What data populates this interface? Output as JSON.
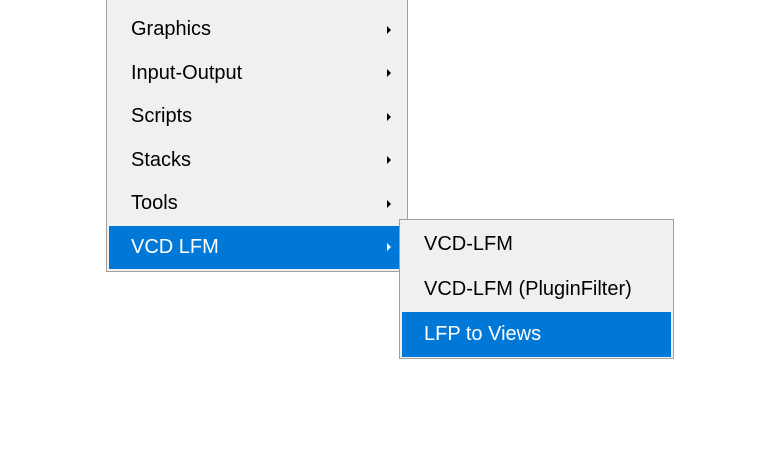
{
  "main_menu": {
    "items": [
      {
        "label": "Graphics",
        "has_submenu": true
      },
      {
        "label": "Input-Output",
        "has_submenu": true
      },
      {
        "label": "Scripts",
        "has_submenu": true
      },
      {
        "label": "Stacks",
        "has_submenu": true
      },
      {
        "label": "Tools",
        "has_submenu": true
      },
      {
        "label": "VCD LFM",
        "has_submenu": true,
        "highlighted": true
      }
    ]
  },
  "sub_menu": {
    "items": [
      {
        "label": "VCD-LFM"
      },
      {
        "label": "VCD-LFM (PluginFilter)"
      },
      {
        "label": "LFP to Views",
        "highlighted": true
      }
    ]
  },
  "colors": {
    "menu_background": "#f0f0f0",
    "highlight": "#0078d7",
    "highlight_text": "#ffffff",
    "border": "#a0a0a0"
  },
  "icons": {
    "submenu_arrow": "chevron-right-icon"
  }
}
